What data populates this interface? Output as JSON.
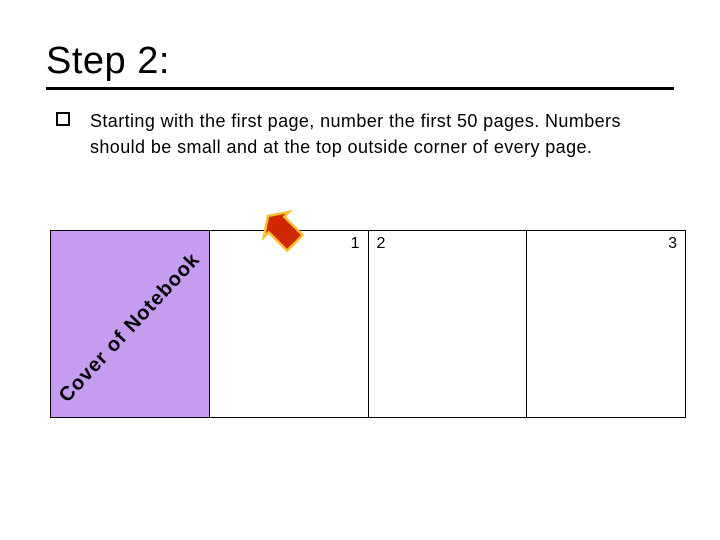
{
  "title": "Step 2:",
  "bullet": "Starting with the first page, number the first 50 pages. Numbers should be small and at the top outside corner of every page.",
  "cover_label": "Cover of Notebook",
  "pages": {
    "p1": "1",
    "p2": "2",
    "p3": "3"
  }
}
